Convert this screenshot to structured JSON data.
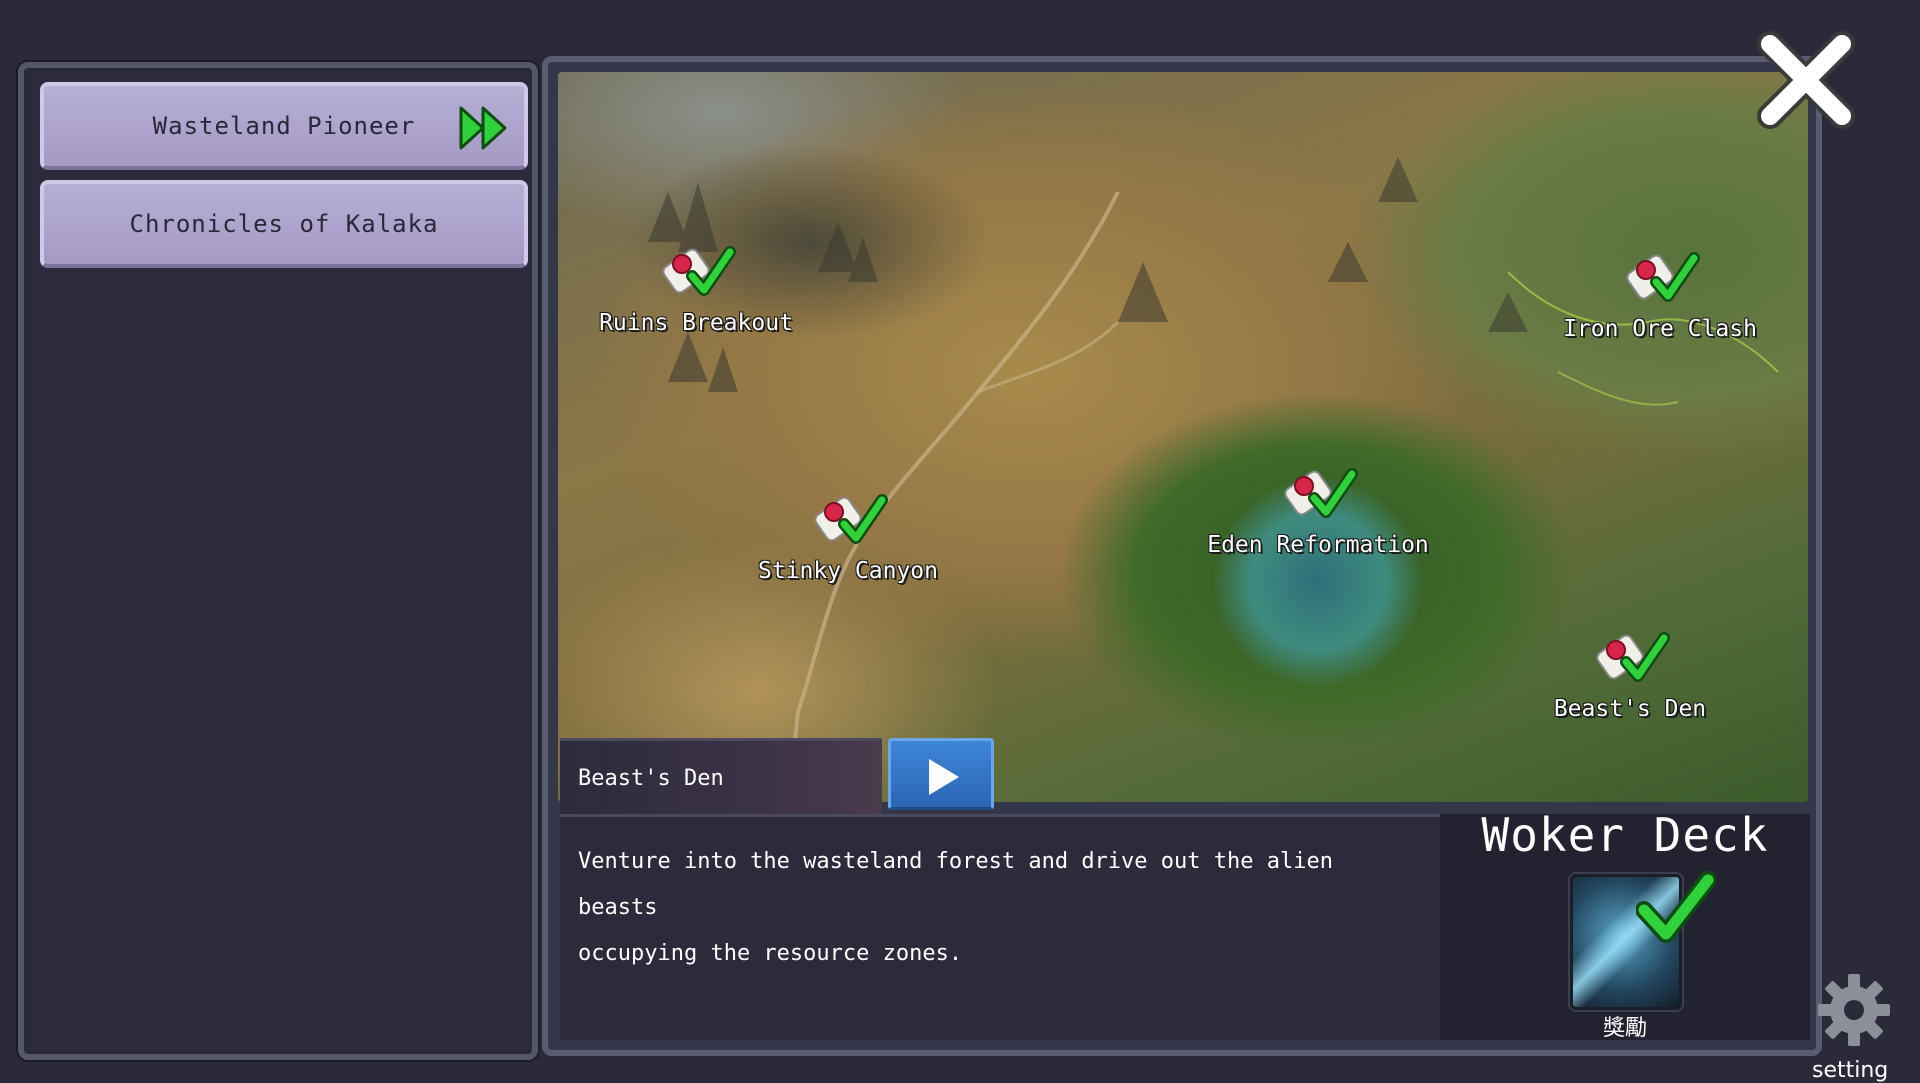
{
  "chapters": [
    {
      "label": "Wasteland Pioneer",
      "active": true,
      "icon": "fast-forward-icon"
    },
    {
      "label": "Chronicles of Kalaka",
      "active": false
    }
  ],
  "map": {
    "markers": [
      {
        "name": "Ruins Breakout",
        "completed": true
      },
      {
        "name": "Iron Ore Clash",
        "completed": true
      },
      {
        "name": "Stinky Canyon",
        "completed": true
      },
      {
        "name": "Eden Reformation",
        "completed": true
      },
      {
        "name": "Beast's Den",
        "completed": true
      }
    ]
  },
  "selected_stage": {
    "name": "Beast's Den",
    "description_line1": "Venture into the wasteland forest and drive out the alien beasts",
    "description_line2": "occupying the resource zones."
  },
  "reward": {
    "title": "Woker Deck",
    "label": "獎勵",
    "completed": true
  },
  "buttons": {
    "play_icon": "play-icon",
    "close_icon": "close-icon",
    "setting_icon": "gear-icon",
    "setting_label": "setting"
  },
  "colors": {
    "check_green": "#2fd23a",
    "play_blue": "#2f75c8",
    "button_lavender": "#aba2cb",
    "panel_bg": "#2c2b3b"
  }
}
